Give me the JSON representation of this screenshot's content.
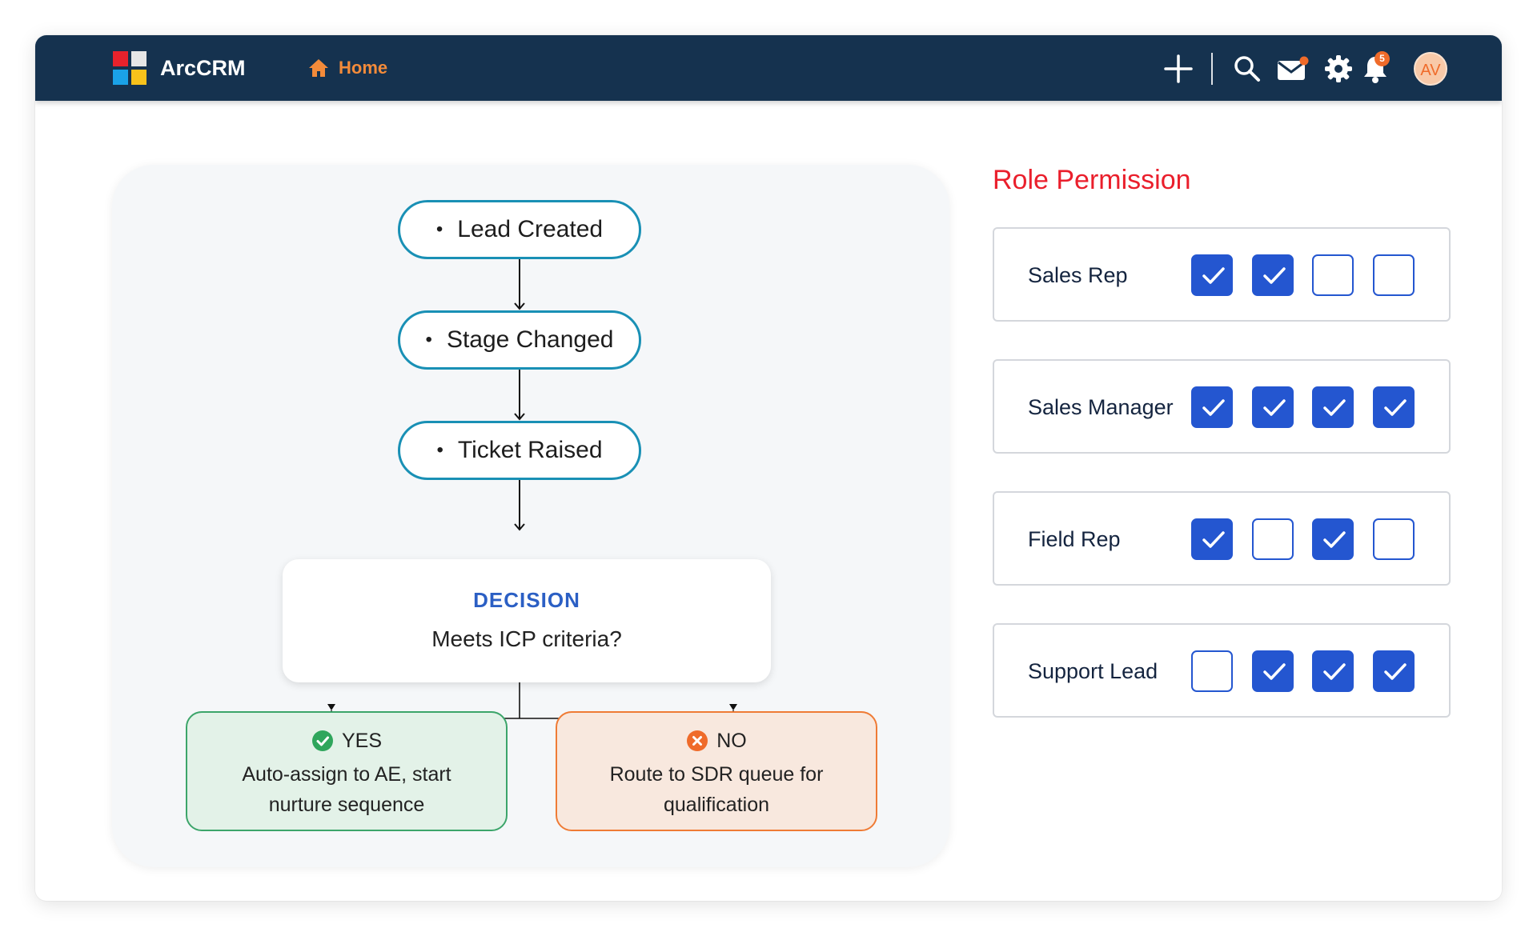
{
  "topbar": {
    "brand": "ArcCRM",
    "home_label": "Home",
    "notification_count": "5",
    "avatar_initials": "AV",
    "icons": [
      "add-icon",
      "search-icon",
      "mail-icon",
      "gear-icon",
      "bell-icon"
    ]
  },
  "flow": {
    "steps": [
      "Lead Created",
      "Stage Changed",
      "Ticket Raised"
    ],
    "decision": {
      "label": "DECISION",
      "question": "Meets ICP criteria?"
    },
    "yes": {
      "label": "YES",
      "text": "Auto-assign to AE, start nurture sequence"
    },
    "no": {
      "label": "NO",
      "text": "Route to SDR queue for qualification"
    }
  },
  "permissions": {
    "title": "Role Permission",
    "roles": [
      {
        "name": "Sales Rep",
        "checks": [
          true,
          true,
          false,
          false
        ]
      },
      {
        "name": "Sales Manager",
        "checks": [
          true,
          true,
          true,
          true
        ]
      },
      {
        "name": "Field Rep",
        "checks": [
          true,
          false,
          true,
          false
        ]
      },
      {
        "name": "Support Lead",
        "checks": [
          false,
          true,
          true,
          true
        ]
      }
    ]
  },
  "colors": {
    "topbar": "#15324f",
    "accent_orange": "#f38b3a",
    "pill_border": "#1990b5",
    "decision_label": "#2b5fc4",
    "yes_border": "#3ca56a",
    "no_border": "#ef7b35",
    "role_title": "#ea1f2c",
    "checkbox": "#2456d0"
  }
}
